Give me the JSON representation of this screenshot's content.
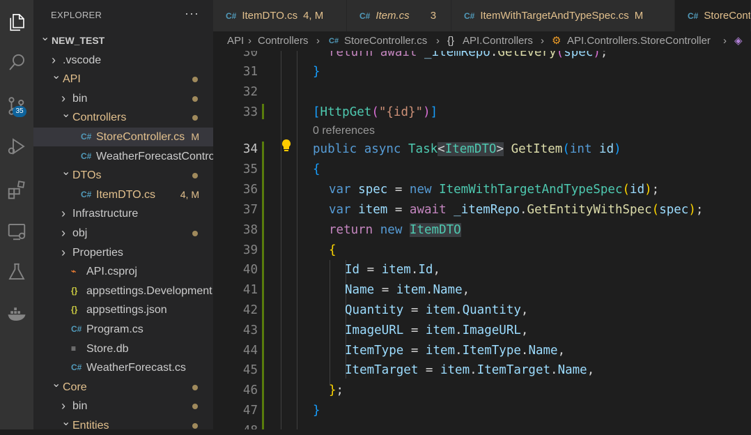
{
  "activity_bar": {
    "items": [
      {
        "name": "explorer-icon"
      },
      {
        "name": "search-icon"
      },
      {
        "name": "source-control-icon",
        "badge": "35"
      },
      {
        "name": "run-debug-icon"
      },
      {
        "name": "extensions-icon"
      },
      {
        "name": "remote-explorer-icon"
      },
      {
        "name": "testing-icon"
      },
      {
        "name": "docker-icon"
      }
    ]
  },
  "sidebar": {
    "title": "EXPLORER",
    "more_actions": "···",
    "tree": [
      {
        "label": "NEW_TEST",
        "type": "root",
        "expanded": true
      },
      {
        "label": ".vscode",
        "type": "folder",
        "expanded": false
      },
      {
        "label": "API",
        "type": "folder",
        "expanded": true,
        "modified": true
      },
      {
        "label": "bin",
        "type": "folder",
        "expanded": false,
        "dot": true
      },
      {
        "label": "Controllers",
        "type": "folder",
        "expanded": true,
        "modified": true
      },
      {
        "label": "StoreController.cs",
        "type": "cs",
        "modified": true,
        "badge": "M",
        "selected": true
      },
      {
        "label": "WeatherForecastControll...",
        "type": "cs"
      },
      {
        "label": "DTOs",
        "type": "folder",
        "expanded": true,
        "modified": true
      },
      {
        "label": "ItemDTO.cs",
        "type": "cs",
        "modified": true,
        "badge": "4, M"
      },
      {
        "label": "Infrastructure",
        "type": "folder",
        "expanded": false
      },
      {
        "label": "obj",
        "type": "folder",
        "expanded": false,
        "dot": true
      },
      {
        "label": "Properties",
        "type": "folder",
        "expanded": false
      },
      {
        "label": "API.csproj",
        "type": "rss"
      },
      {
        "label": "appsettings.Development.j...",
        "type": "json"
      },
      {
        "label": "appsettings.json",
        "type": "json"
      },
      {
        "label": "Program.cs",
        "type": "cs"
      },
      {
        "label": "Store.db",
        "type": "db"
      },
      {
        "label": "WeatherForecast.cs",
        "type": "cs"
      },
      {
        "label": "Core",
        "type": "folder",
        "expanded": true,
        "modified": true
      },
      {
        "label": "bin",
        "type": "folder",
        "expanded": false,
        "dot": true
      },
      {
        "label": "Entities",
        "type": "folder",
        "expanded": true,
        "modified": true
      }
    ]
  },
  "tabs": [
    {
      "label": "ItemDTO.cs",
      "badge": "4, M"
    },
    {
      "label": "Item.cs",
      "badge": "3",
      "italic": true
    },
    {
      "label": "ItemWithTargetAndTypeSpec.cs",
      "badge": "M"
    },
    {
      "label": "StoreCont",
      "active": true
    }
  ],
  "breadcrumb": [
    "API",
    "Controllers",
    "StoreController.cs",
    "API.Controllers",
    "API.Controllers.StoreController"
  ],
  "editor": {
    "codelens": "0 references",
    "current_line": "34"
  },
  "colors": {
    "modified": "#e2c08d",
    "badge_bg": "#0e639c",
    "keyword": "#569cd6",
    "type": "#4ec9b0"
  }
}
